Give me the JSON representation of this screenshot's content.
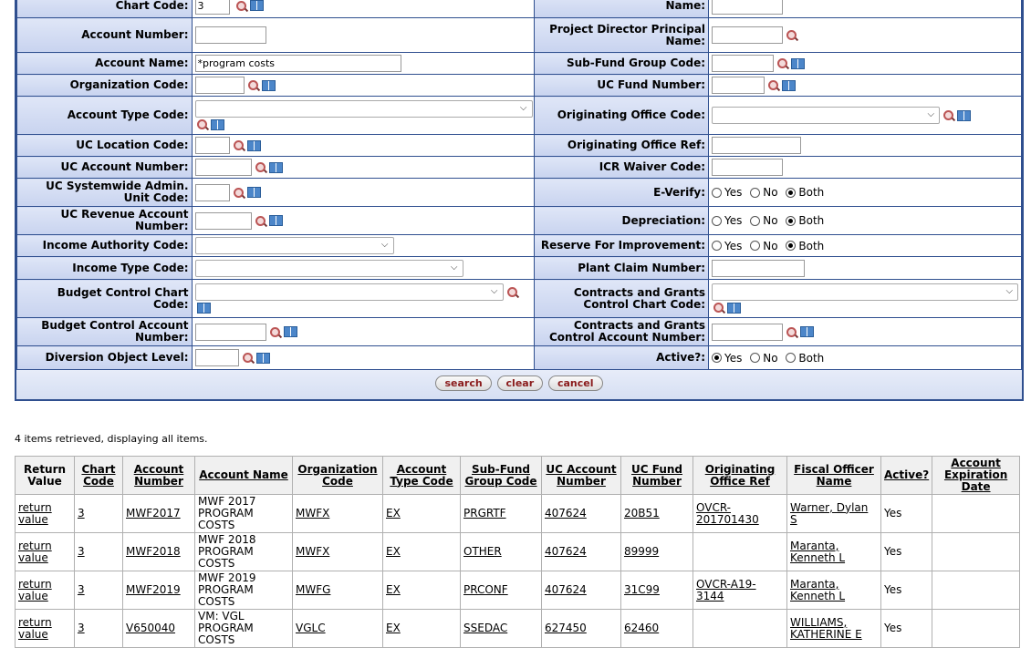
{
  "form": {
    "rows": [
      {
        "left_label": "Chart Code:",
        "left_value": "3",
        "right_label": "Name:"
      },
      {
        "left_label": "Account Number:",
        "left_value": "",
        "right_label": "Project Director Principal Name:",
        "right_value": ""
      },
      {
        "left_label": "Account Name:",
        "left_value": "*program costs",
        "right_label": "Sub-Fund Group Code:",
        "right_value": ""
      },
      {
        "left_label": "Organization Code:",
        "left_value": "",
        "right_label": "UC Fund Number:",
        "right_value": ""
      },
      {
        "left_label": "Account Type Code:",
        "right_label": "Originating Office Code:"
      },
      {
        "left_label": "UC Location Code:",
        "left_value": "",
        "right_label": "Originating Office Ref:",
        "right_value": ""
      },
      {
        "left_label": "UC Account Number:",
        "left_value": "",
        "right_label": "ICR Waiver Code:",
        "right_value": ""
      },
      {
        "left_label": "UC Systemwide Admin. Unit Code:",
        "left_value": "",
        "right_label": "E-Verify:"
      },
      {
        "left_label": "UC Revenue Account Number:",
        "left_value": "",
        "right_label": "Depreciation:"
      },
      {
        "left_label": "Income Authority Code:",
        "right_label": "Reserve For Improvement:"
      },
      {
        "left_label": "Income Type Code:",
        "right_label": "Plant Claim Number:",
        "right_value": ""
      },
      {
        "left_label": "Budget Control Chart Code:",
        "right_label": "Contracts and Grants Control Chart Code:"
      },
      {
        "left_label": "Budget Control Account Number:",
        "left_value": "",
        "right_label": "Contracts and Grants Control Account Number:",
        "right_value": ""
      },
      {
        "left_label": "Diversion Object Level:",
        "left_value": "",
        "right_label": "Active?:"
      }
    ],
    "radio_options": [
      "Yes",
      "No",
      "Both"
    ],
    "buttons": {
      "search": "search",
      "clear": "clear",
      "cancel": "cancel"
    }
  },
  "results": {
    "count_text": "4 items retrieved, displaying all items.",
    "headers": [
      "Return Value",
      "Chart Code",
      "Account Number",
      "Account Name",
      "Organization Code",
      "Account Type Code",
      "Sub-Fund Group Code",
      "UC Account Number",
      "UC Fund Number",
      "Originating Office Ref",
      "Fiscal Officer Name",
      "Active?",
      "Account Expiration Date"
    ],
    "rows": [
      [
        "return value",
        "3",
        "MWF2017",
        "MWF 2017 PROGRAM COSTS",
        "MWFX",
        "EX",
        "PRGRTF",
        "407624",
        "20B51",
        "OVCR-201701430",
        "Warner, Dylan S",
        "Yes",
        ""
      ],
      [
        "return value",
        "3",
        "MWF2018",
        "MWF 2018 PROGRAM COSTS",
        "MWFX",
        "EX",
        "OTHER",
        "407624",
        "89999",
        "",
        "Maranta, Kenneth L",
        "Yes",
        ""
      ],
      [
        "return value",
        "3",
        "MWF2019",
        "MWF 2019 PROGRAM COSTS",
        "MWFG",
        "EX",
        "PRCONF",
        "407624",
        "31C99",
        "OVCR-A19-3144",
        "Maranta, Kenneth L",
        "Yes",
        ""
      ],
      [
        "return value",
        "3",
        "V650040",
        "VM: VGL PROGRAM COSTS",
        "VGLC",
        "EX",
        "SSEDAC",
        "627450",
        "62460",
        "",
        "WILLIAMS, KATHERINE E",
        "Yes",
        ""
      ]
    ]
  }
}
